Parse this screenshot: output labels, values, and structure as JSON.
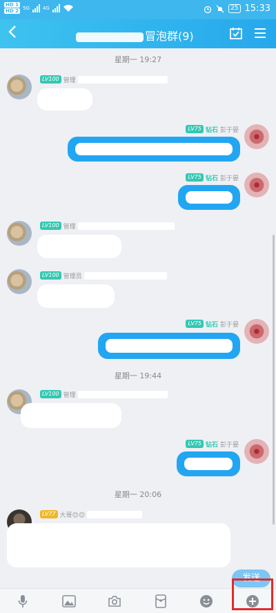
{
  "status_bar": {
    "hd1": "HD 1",
    "hd2": "HD 2",
    "net1": "5G",
    "net2": "4G",
    "battery": "25",
    "time": "15:33"
  },
  "header": {
    "back_icon": "chevron-left-icon",
    "title_visible": "冒泡群(9)",
    "checkin_icon": "calendar-check-icon",
    "menu_icon": "hamburger-menu-icon"
  },
  "messages": [
    {
      "type": "time",
      "text": "星期一 19:27"
    },
    {
      "type": "incoming",
      "level": "LV100",
      "role": "管理"
    },
    {
      "type": "outgoing",
      "level": "LV75",
      "tier": "钻石",
      "name": "彭于晏"
    },
    {
      "type": "outgoing",
      "level": "LV75",
      "tier": "钻石",
      "name": "彭于晏"
    },
    {
      "type": "incoming",
      "level": "LV100",
      "role": "管理"
    },
    {
      "type": "incoming",
      "level": "LV100",
      "role": "管理员"
    },
    {
      "type": "outgoing",
      "level": "LV75",
      "tier": "钻石",
      "name": "彭于晏"
    },
    {
      "type": "time",
      "text": "星期一 19:44"
    },
    {
      "type": "incoming",
      "level": "LV100",
      "role": "管理"
    },
    {
      "type": "outgoing",
      "level": "LV75",
      "tier": "钻石",
      "name": "彭于晏"
    },
    {
      "type": "time",
      "text": "星期一 20:06"
    },
    {
      "type": "incoming",
      "level": "LV77",
      "role": "大哥😊😊"
    }
  ],
  "input": {
    "send_label": "发送"
  },
  "toolbar": {
    "items": [
      "microphone-icon",
      "image-icon",
      "camera-icon",
      "red-packet-icon",
      "emoji-icon",
      "plus-icon"
    ]
  }
}
